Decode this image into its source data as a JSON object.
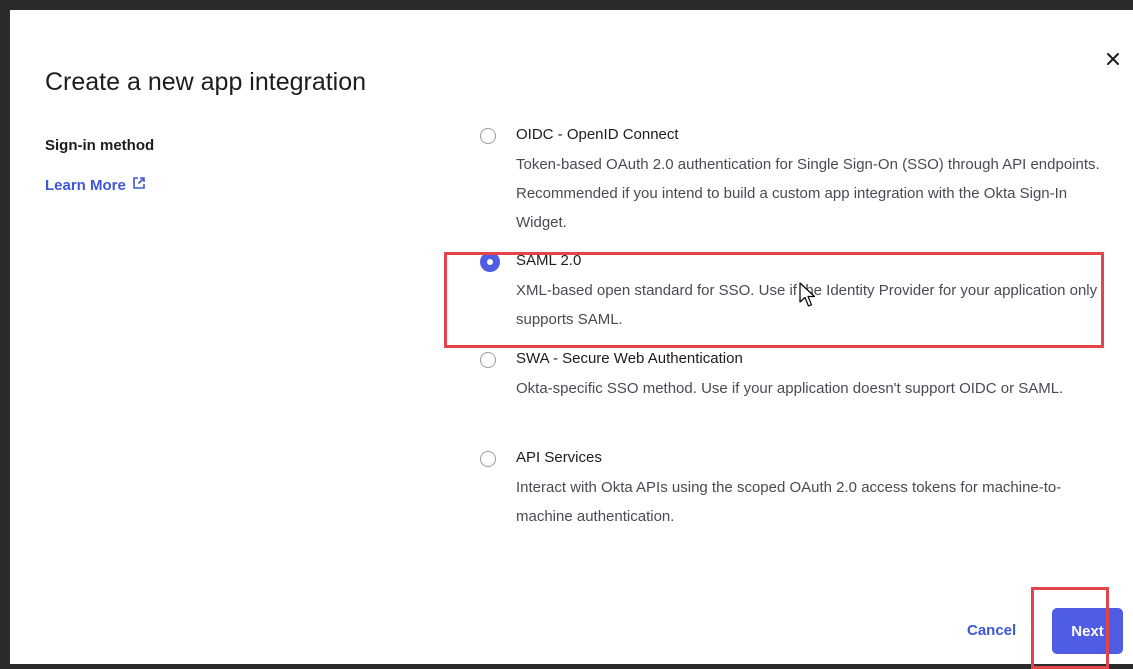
{
  "dialog": {
    "title": "Create a new app integration",
    "section_label": "Sign-in method",
    "learn_more": "Learn More",
    "options": [
      {
        "title": "OIDC - OpenID Connect",
        "description": "Token-based OAuth 2.0 authentication for Single Sign-On (SSO) through API endpoints. Recommended if you intend to build a custom app integration with the Okta Sign-In Widget.",
        "selected": false
      },
      {
        "title": "SAML 2.0",
        "description": "XML-based open standard for SSO. Use if the Identity Provider for your application only supports SAML.",
        "selected": true
      },
      {
        "title": "SWA - Secure Web Authentication",
        "description": "Okta-specific SSO method. Use if your application doesn't support OIDC or SAML.",
        "selected": false
      },
      {
        "title": "API Services",
        "description": "Interact with Okta APIs using the scoped OAuth 2.0 access tokens for machine-to-machine authentication.",
        "selected": false
      }
    ],
    "cancel_label": "Cancel",
    "next_label": "Next"
  },
  "colors": {
    "accent": "#4f5ce4",
    "link": "#3e56d9",
    "highlight": "#e4454b"
  },
  "icons": {
    "close": "close-icon",
    "external_link": "external-link-icon",
    "cursor": "mouse-cursor-icon"
  }
}
